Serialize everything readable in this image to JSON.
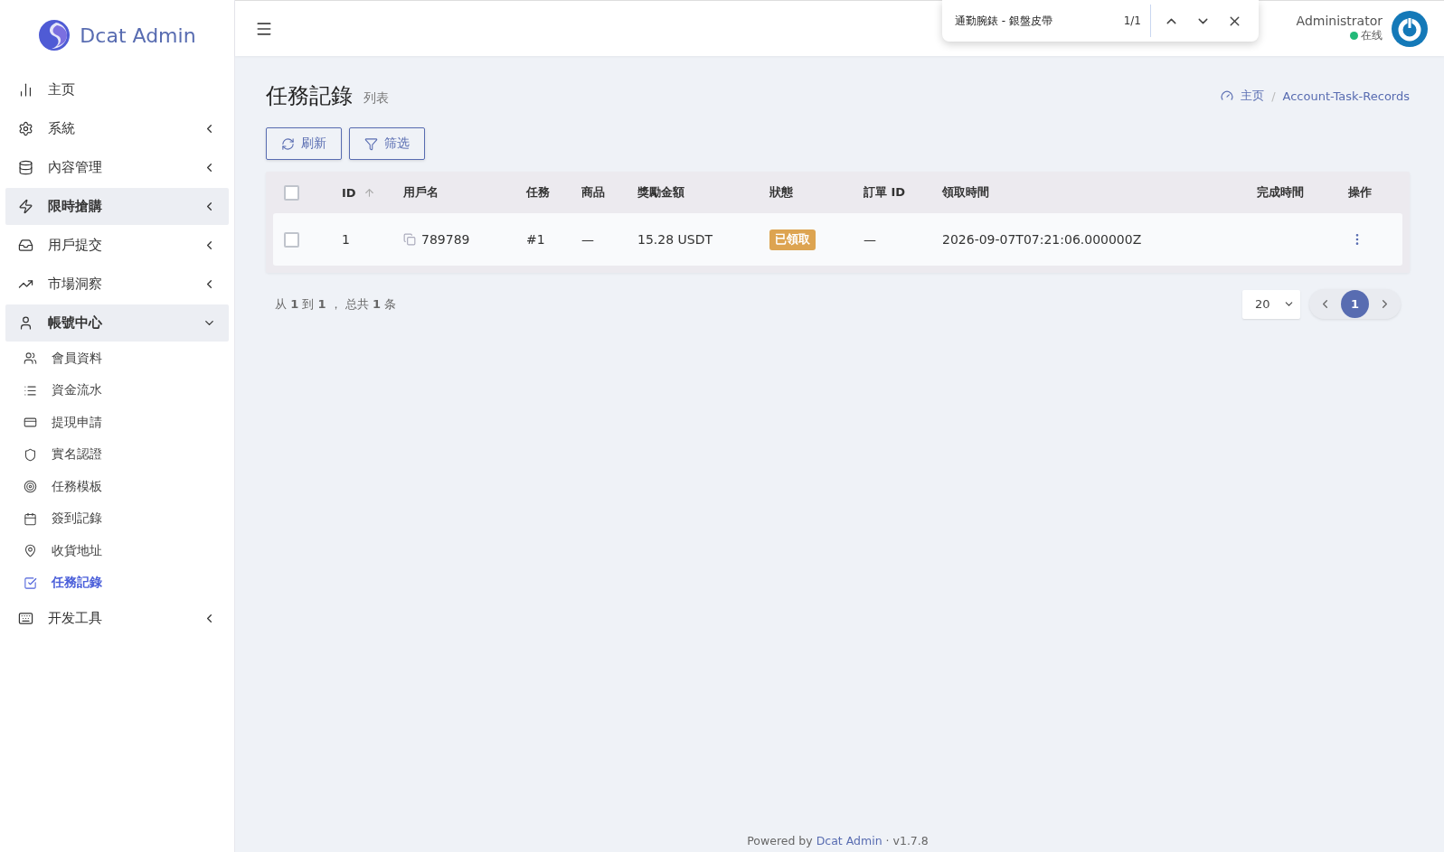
{
  "brand": {
    "name": "Dcat Admin"
  },
  "sidebar": {
    "items": [
      {
        "label": "主页",
        "selected": false
      },
      {
        "label": "系統",
        "expanded": false,
        "selected": false
      },
      {
        "label": "內容管理",
        "expanded": false,
        "selected": false
      },
      {
        "label": "限時搶購",
        "expanded": false,
        "selected": true
      },
      {
        "label": "用戶提交",
        "expanded": false,
        "selected": false
      },
      {
        "label": "市場洞察",
        "expanded": false,
        "selected": false
      },
      {
        "label": "帳號中心",
        "expanded": true,
        "selected": true,
        "children": [
          {
            "label": "會員資料",
            "selected": false
          },
          {
            "label": "資金流水",
            "selected": false
          },
          {
            "label": "提現申請",
            "selected": false
          },
          {
            "label": "實名認證",
            "selected": false
          },
          {
            "label": "任務模板",
            "selected": false
          },
          {
            "label": "簽到記錄",
            "selected": false
          },
          {
            "label": "收貨地址",
            "selected": false
          },
          {
            "label": "任務記錄",
            "selected": true
          }
        ]
      },
      {
        "label": "开发工具",
        "expanded": false,
        "selected": false
      }
    ]
  },
  "find_bar": {
    "query": "通勤腕錶 - 銀盤皮帶",
    "count": "1/1"
  },
  "user": {
    "name": "Administrator",
    "status": "在线",
    "online": true
  },
  "page": {
    "title": "任務記錄",
    "subtitle": "列表"
  },
  "breadcrumb": {
    "items": [
      "主页",
      "Account-Task-Records"
    ],
    "separator": "/"
  },
  "toolbar": [
    "刷新",
    "筛选"
  ],
  "table": {
    "columns": [
      "ID",
      "用戶名",
      "任務",
      "商品",
      "獎勵金額",
      "狀態",
      "訂單 ID",
      "領取時間",
      "完成時間",
      "操作"
    ],
    "header_checked": false,
    "rows": [
      {
        "checked": false,
        "id": "1",
        "username": "789789",
        "task": "#1",
        "product": "—",
        "reward": "15.28 USDT",
        "status": "已領取",
        "order_id": "—",
        "claimed_at": "2026-09-07T07:21:06.000000Z"
      }
    ]
  },
  "pagination": {
    "summary": "从 **1** 到 **1** ， 总共 **1** 条",
    "per_page": "20",
    "pages": [
      {
        "label": "1",
        "selected": true
      }
    ]
  },
  "footer": {
    "prefix": "Powered by",
    "link": "Dcat Admin",
    "suffix": "· v1.7.8"
  }
}
